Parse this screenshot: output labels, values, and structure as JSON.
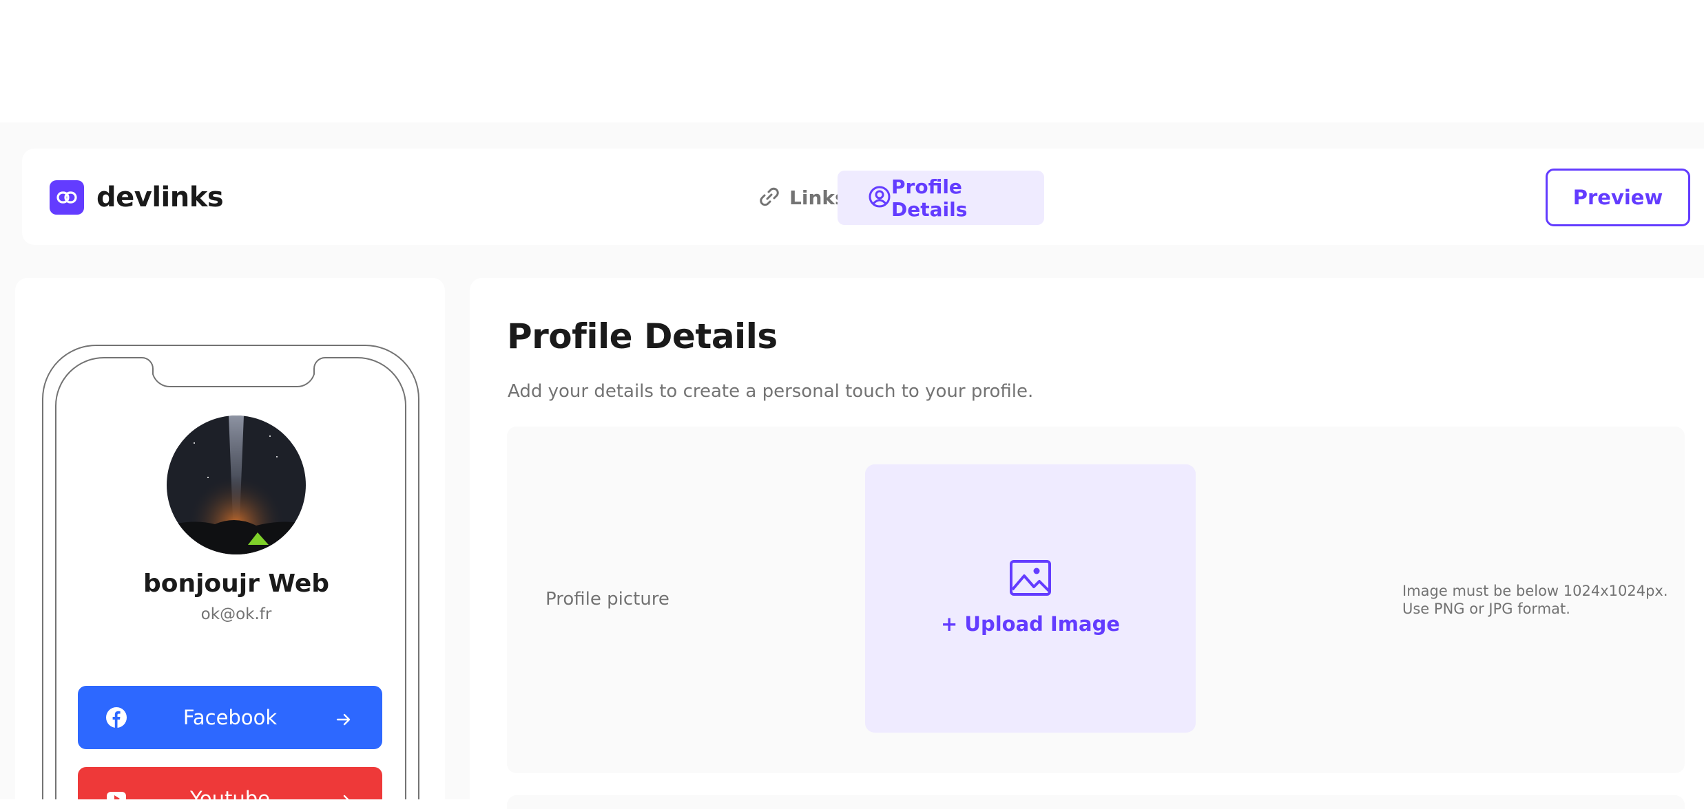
{
  "app": {
    "name": "devlinks"
  },
  "nav": {
    "tabs": [
      {
        "label": "Links",
        "icon": "link-icon",
        "active": false
      },
      {
        "label": "Profile Details",
        "icon": "user-circle-icon",
        "active": true
      }
    ],
    "preview_label": "Preview"
  },
  "preview_phone": {
    "name": "bonjoujr Web",
    "email": "ok@ok.fr",
    "links": [
      {
        "platform": "Facebook",
        "icon": "facebook-icon",
        "color": "#2d68ff"
      },
      {
        "platform": "Youtube",
        "icon": "youtube-icon",
        "color": "#ee3939"
      }
    ]
  },
  "profile": {
    "title": "Profile Details",
    "subtitle": "Add your details to create a personal touch to your profile.",
    "picture_label": "Profile picture",
    "upload_label": "+ Upload Image",
    "hint_line1": "Image must be below 1024x1024px.",
    "hint_line2": "Use PNG or JPG format."
  },
  "colors": {
    "accent": "#633cff",
    "accent_light": "#efebff",
    "text_dark": "#1a1a1a",
    "text_gray": "#737373"
  }
}
